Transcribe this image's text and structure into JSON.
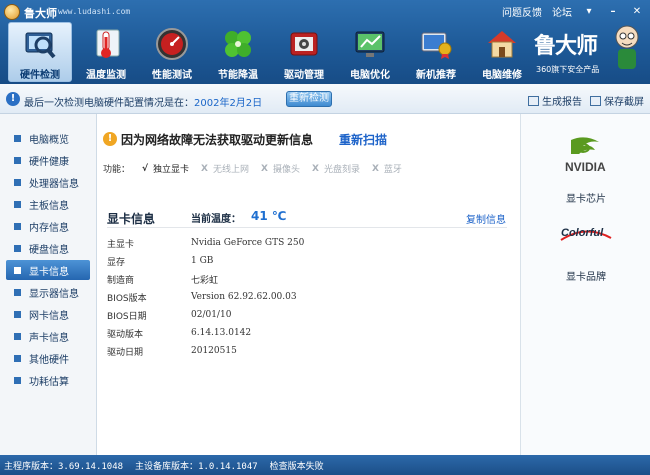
{
  "titlebar": {
    "title": "鲁大师",
    "url": "www.ludashi.com",
    "links": [
      "问题反馈",
      "论坛"
    ],
    "win_buttons": [
      "▾",
      "–",
      "✕"
    ]
  },
  "toolbar": {
    "items": [
      {
        "label": "硬件检测",
        "icon": "hardware-scan-icon",
        "active": true
      },
      {
        "label": "温度监测",
        "icon": "thermometer-icon",
        "active": false
      },
      {
        "label": "性能测试",
        "icon": "speedometer-icon",
        "active": false
      },
      {
        "label": "节能降温",
        "icon": "clover-icon",
        "active": false
      },
      {
        "label": "驱动管理",
        "icon": "driver-chip-icon",
        "active": false
      },
      {
        "label": "电脑优化",
        "icon": "monitor-optimize-icon",
        "active": false
      },
      {
        "label": "新机推荐",
        "icon": "award-monitor-icon",
        "active": false
      },
      {
        "label": "电脑维修",
        "icon": "house-icon",
        "active": false
      }
    ]
  },
  "brand": {
    "name": "鲁大师",
    "tagline": "360旗下安全产品"
  },
  "infobar": {
    "text_prefix": "最后一次检测电脑硬件配置情况是在：",
    "date": "2002年2月2日",
    "recheck_label": "重新检测",
    "actions": [
      "生成报告",
      "保存截屏"
    ]
  },
  "sidebar": {
    "items": [
      {
        "label": "电脑概览",
        "active": false
      },
      {
        "label": "硬件健康",
        "active": false
      },
      {
        "label": "处理器信息",
        "active": false
      },
      {
        "label": "主板信息",
        "active": false
      },
      {
        "label": "内存信息",
        "active": false
      },
      {
        "label": "硬盘信息",
        "active": false
      },
      {
        "label": "显卡信息",
        "active": true
      },
      {
        "label": "显示器信息",
        "active": false
      },
      {
        "label": "网卡信息",
        "active": false
      },
      {
        "label": "声卡信息",
        "active": false
      },
      {
        "label": "其他硬件",
        "active": false
      },
      {
        "label": "功耗估算",
        "active": false
      }
    ]
  },
  "main": {
    "warning": "因为网络故障无法获取驱动更新信息",
    "rescan_label": "重新扫描",
    "functions_label": "功能：",
    "functions": [
      {
        "mark": "√",
        "label": "独立显卡",
        "enabled": true
      },
      {
        "mark": "X",
        "label": "无线上网",
        "enabled": false
      },
      {
        "mark": "X",
        "label": "摄像头",
        "enabled": false
      },
      {
        "mark": "X",
        "label": "光盘刻录",
        "enabled": false
      },
      {
        "mark": "X",
        "label": "蓝牙",
        "enabled": false
      }
    ],
    "section_title": "显卡信息",
    "temp_label": "当前温度：",
    "temp_value": "41 ℃",
    "copy_label": "复制信息",
    "specs": [
      {
        "key": "主显卡",
        "value": "Nvidia GeForce GTS 250"
      },
      {
        "key": "显存",
        "value": "1 GB"
      },
      {
        "key": "制造商",
        "value": "七彩虹"
      },
      {
        "key": "BIOS版本",
        "value": "Version 62.92.62.00.03"
      },
      {
        "key": "BIOS日期",
        "value": "02/01/10"
      },
      {
        "key": "驱动版本",
        "value": "6.14.13.0142"
      },
      {
        "key": "驱动日期",
        "value": "20120515"
      }
    ]
  },
  "right_panel": {
    "chip_logo_text": "NVIDIA",
    "chip_label": "显卡芯片",
    "brand_logo_text": "Colorful",
    "brand_label": "显卡品牌"
  },
  "statusbar": {
    "program_label": "主程序版本：",
    "program_version": "3.69.14.1048",
    "db_label": "主设备库版本：",
    "db_version": "1.0.14.1047",
    "update_status": "检查版本失败"
  }
}
